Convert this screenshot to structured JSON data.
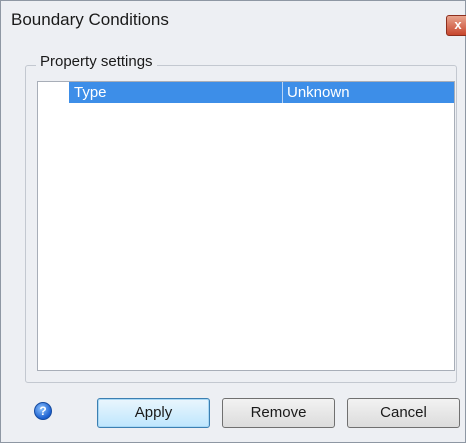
{
  "window": {
    "title": "Boundary Conditions",
    "close_glyph": "x"
  },
  "group": {
    "legend": "Property settings"
  },
  "properties": {
    "rows": [
      {
        "name": "Type",
        "value": "Unknown",
        "selected": true
      }
    ]
  },
  "footer": {
    "help_icon": "help-icon",
    "apply_label": "Apply",
    "remove_label": "Remove",
    "cancel_label": "Cancel"
  },
  "colors": {
    "selection": "#3d8ee8",
    "dialog_bg": "#edeff3"
  }
}
